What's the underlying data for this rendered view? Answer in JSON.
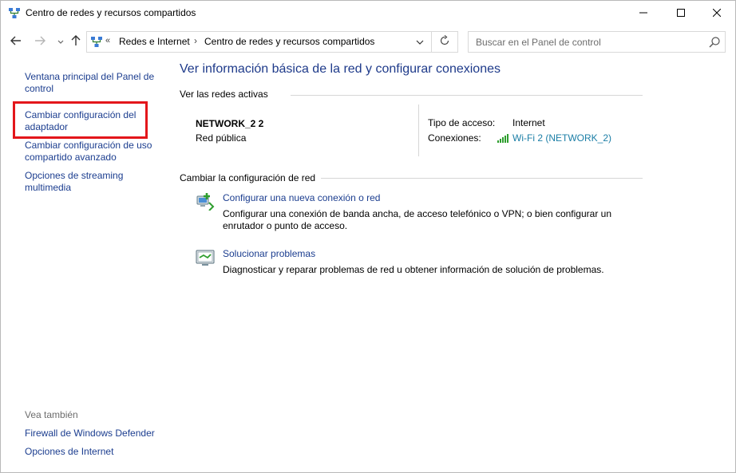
{
  "window": {
    "title": "Centro de redes y recursos compartidos",
    "icon": "network-center-icon",
    "controls": [
      "minimize-icon",
      "maximize-icon",
      "close-icon"
    ]
  },
  "address_bar": {
    "overflow": "«",
    "breadcrumbs": [
      "Redes e Internet",
      "Centro de redes y recursos compartidos"
    ],
    "separator": "›"
  },
  "search": {
    "placeholder": "Buscar en el Panel de control"
  },
  "left_pane": {
    "links": [
      "Ventana principal del Panel de control",
      "Cambiar configuración del adaptador",
      "Cambiar configuración de uso compartido avanzado",
      "Opciones de streaming multimedia"
    ],
    "see_also_label": "Vea también",
    "see_also_links": [
      "Firewall de Windows Defender",
      "Opciones de Internet"
    ],
    "highlight_color": "#e3161b"
  },
  "main": {
    "title": "Ver información básica de la red y configurar conexiones",
    "active_networks_header": "Ver las redes activas",
    "network": {
      "name": "NETWORK_2 2",
      "type": "Red pública",
      "access_label": "Tipo de acceso:",
      "access_value": "Internet",
      "connections_label": "Conexiones:",
      "connection_link": "Wi-Fi 2 (NETWORK_2)"
    },
    "change_header": "Cambiar la configuración de red",
    "tasks": [
      {
        "icon": "new-connection-icon",
        "link": "Configurar una nueva conexión o red",
        "description": "Configurar una conexión de banda ancha, de acceso telefónico o VPN; o bien configurar un enrutador o punto de acceso."
      },
      {
        "icon": "troubleshoot-icon",
        "link": "Solucionar problemas",
        "description": "Diagnosticar y reparar problemas de red u obtener información de solución de problemas."
      }
    ]
  },
  "colors": {
    "link": "#1b3d8f",
    "title": "#1e3a8a",
    "connection_link": "#1b7ea6",
    "highlight": "#e3161b"
  }
}
